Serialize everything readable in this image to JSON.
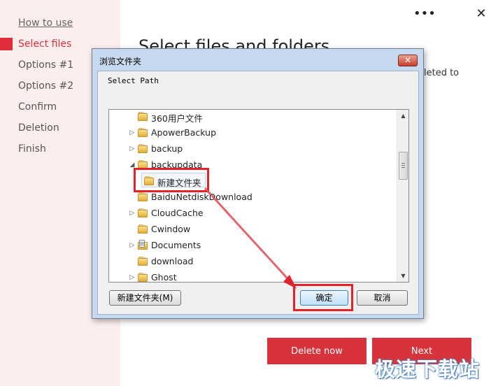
{
  "sidebar": {
    "steps": [
      "How to use",
      "Select files",
      "Options #1",
      "Options #2",
      "Confirm",
      "Deletion",
      "Finish"
    ],
    "active": "Select files"
  },
  "main": {
    "title": "Select files and folders",
    "desc_fragment": "eleted to"
  },
  "header": {
    "menu_glyph": "•••",
    "close_glyph": "✕"
  },
  "actions": {
    "delete_label": "Delete now",
    "next_label": "Next"
  },
  "watermark": "极速下载站",
  "dialog": {
    "title": "浏览文件夹",
    "close_glyph": "✕",
    "prompt": "Select Path",
    "tree": [
      {
        "label": "360用户文件",
        "arrow": "",
        "icon": "folder"
      },
      {
        "label": "ApowerBackup",
        "arrow": "▷",
        "icon": "folder"
      },
      {
        "label": "backup",
        "arrow": "▷",
        "icon": "folder"
      },
      {
        "label": "backupdata",
        "arrow": "◢",
        "icon": "folder"
      },
      {
        "label": "新建文件夹",
        "arrow": "",
        "icon": "folder",
        "selected": true
      },
      {
        "label": "BaiduNetdiskDownload",
        "arrow": "",
        "icon": "folder"
      },
      {
        "label": "CloudCache",
        "arrow": "▷",
        "icon": "folder"
      },
      {
        "label": "Cwindow",
        "arrow": "",
        "icon": "folder"
      },
      {
        "label": "Documents",
        "arrow": "▷",
        "icon": "documents"
      },
      {
        "label": "download",
        "arrow": "",
        "icon": "folder"
      },
      {
        "label": "Ghost",
        "arrow": "▷",
        "icon": "folder"
      }
    ],
    "scroll_up": "▲",
    "scroll_down": "▼",
    "new_folder_label": "新建文件夹(M)",
    "ok_label": "确定",
    "cancel_label": "取消"
  },
  "colors": {
    "accent": "#d8323b",
    "sidebar_bg": "#fdeeee",
    "highlight": "#e3222a",
    "dialog_frame": "#c6d9ee"
  }
}
